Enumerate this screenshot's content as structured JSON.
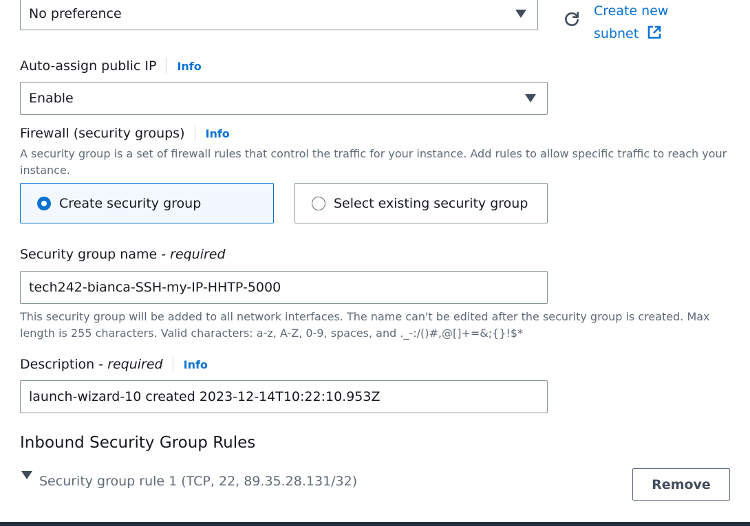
{
  "subnet": {
    "selected_value": "No preference",
    "refresh_icon": "refresh-icon",
    "create_link_line1": "Create new",
    "create_link_line2": "subnet",
    "external_icon": "external-link-icon"
  },
  "auto_assign_ip": {
    "label": "Auto-assign public IP",
    "info": "Info",
    "selected_value": "Enable"
  },
  "firewall": {
    "label": "Firewall (security groups)",
    "info": "Info",
    "description": "A security group is a set of firewall rules that control the traffic for your instance. Add rules to allow specific traffic to reach your instance.",
    "options": [
      {
        "label": "Create security group",
        "selected": true
      },
      {
        "label": "Select existing security group",
        "selected": false
      }
    ]
  },
  "sg_name": {
    "label": "Security group name - ",
    "required": "required",
    "value": "tech242-bianca-SSH-my-IP-HHTP-5000",
    "help": "This security group will be added to all network interfaces. The name can't be edited after the security group is created. Max length is 255 characters. Valid characters: a-z, A-Z, 0-9, spaces, and ._-:/()#,@[]+=&;{}!$*"
  },
  "description": {
    "label": "Description - ",
    "required": "required",
    "info": "Info",
    "value": "launch-wizard-10 created 2023-12-14T10:22:10.953Z"
  },
  "inbound": {
    "title": "Inbound Security Group Rules",
    "rule_label": "Security group rule 1 (TCP, 22, 89.35.28.131/32)",
    "remove_label": "Remove"
  },
  "colors": {
    "link": "#0972d3",
    "selected_bg": "#f2f8fd",
    "border": "#879596",
    "footer": "#232f3e"
  }
}
